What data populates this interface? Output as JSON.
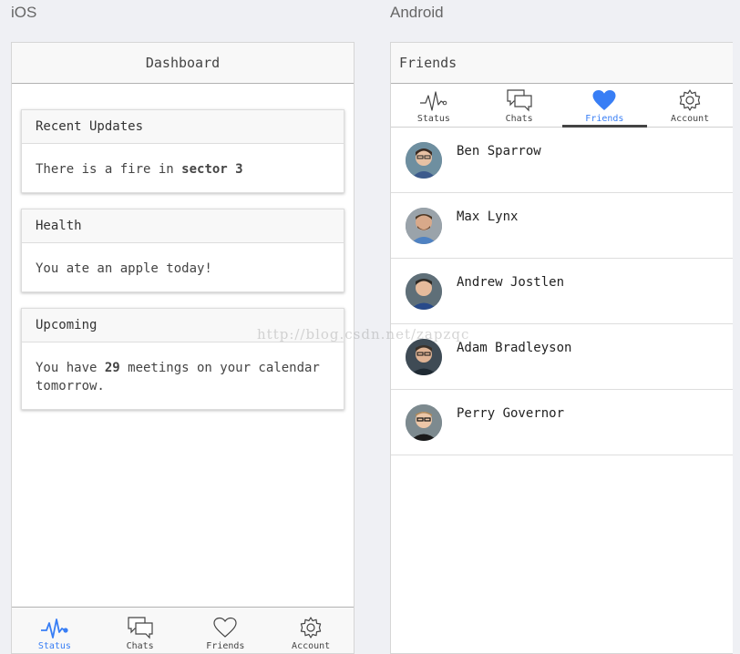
{
  "labels": {
    "ios": "iOS",
    "android": "Android"
  },
  "ios": {
    "title": "Dashboard",
    "cards": [
      {
        "header": "Recent Updates",
        "text_before": "There is a fire in ",
        "bold": "sector 3",
        "text_after": ""
      },
      {
        "header": "Health",
        "text_before": "You ate an apple today!",
        "bold": "",
        "text_after": ""
      },
      {
        "header": "Upcoming",
        "text_before": "You have ",
        "bold": "29",
        "text_after": " meetings on your calendar tomorrow."
      }
    ],
    "tabs": [
      {
        "label": "Status",
        "icon": "pulse-icon",
        "active": true
      },
      {
        "label": "Chats",
        "icon": "chat-bubbles-icon",
        "active": false
      },
      {
        "label": "Friends",
        "icon": "heart-outline-icon",
        "active": false
      },
      {
        "label": "Account",
        "icon": "gear-icon",
        "active": false
      }
    ]
  },
  "android": {
    "title": "Friends",
    "tabs": [
      {
        "label": "Status",
        "icon": "pulse-icon",
        "active": false
      },
      {
        "label": "Chats",
        "icon": "chat-bubbles-icon",
        "active": false
      },
      {
        "label": "Friends",
        "icon": "heart-filled-icon",
        "active": true
      },
      {
        "label": "Account",
        "icon": "gear-icon",
        "active": false
      }
    ],
    "friends": [
      {
        "name": "Ben Sparrow"
      },
      {
        "name": "Max Lynx"
      },
      {
        "name": "Andrew Jostlen"
      },
      {
        "name": "Adam Bradleyson"
      },
      {
        "name": "Perry Governor"
      }
    ]
  },
  "watermark": "http://blog.csdn.net/zapzqc",
  "colors": {
    "accent": "#387ef5",
    "tab_inactive": "#444444",
    "background": "#eff0f4"
  }
}
